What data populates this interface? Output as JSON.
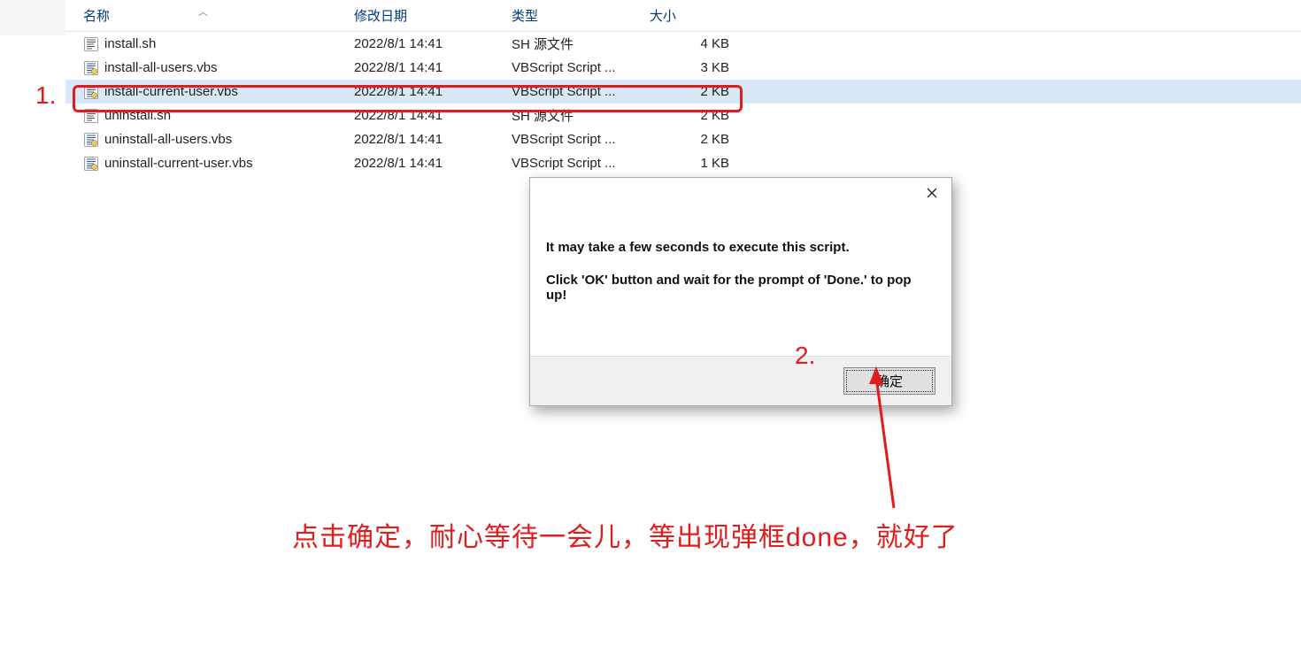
{
  "columns": {
    "name": "名称",
    "date": "修改日期",
    "type": "类型",
    "size": "大小"
  },
  "files": [
    {
      "icon": "sh",
      "name": "install.sh",
      "date": "2022/8/1 14:41",
      "type": "SH 源文件",
      "size": "4 KB"
    },
    {
      "icon": "vbs",
      "name": "install-all-users.vbs",
      "date": "2022/8/1 14:41",
      "type": "VBScript Script ...",
      "size": "3 KB"
    },
    {
      "icon": "vbs",
      "name": "install-current-user.vbs",
      "date": "2022/8/1 14:41",
      "type": "VBScript Script ...",
      "size": "2 KB",
      "highlighted": true
    },
    {
      "icon": "sh",
      "name": "uninstall.sh",
      "date": "2022/8/1 14:41",
      "type": "SH 源文件",
      "size": "2 KB"
    },
    {
      "icon": "vbs",
      "name": "uninstall-all-users.vbs",
      "date": "2022/8/1 14:41",
      "type": "VBScript Script ...",
      "size": "2 KB"
    },
    {
      "icon": "vbs",
      "name": "uninstall-current-user.vbs",
      "date": "2022/8/1 14:41",
      "type": "VBScript Script ...",
      "size": "1 KB"
    }
  ],
  "dialog": {
    "line1": "It may take a few seconds to execute this script.",
    "line2": "Click 'OK' button and wait for the prompt of 'Done.' to pop up!",
    "ok_label": "确定"
  },
  "annotations": {
    "num1": "1.",
    "num2": "2.",
    "caption": "点击确定，耐心等待一会儿，等出现弹框done，就好了"
  }
}
